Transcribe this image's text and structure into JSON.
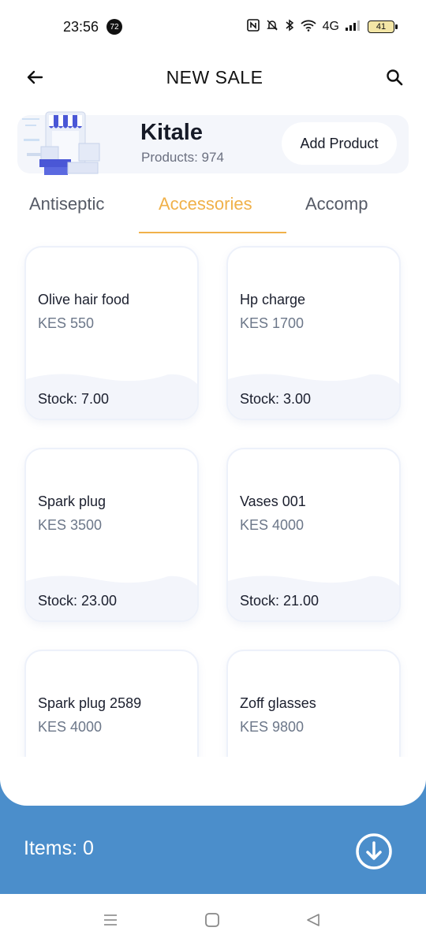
{
  "status_bar": {
    "time": "23:56",
    "notification_count": "72",
    "network": "4G",
    "battery": "41"
  },
  "header": {
    "title": "NEW SALE",
    "back_icon": "arrow-left-icon",
    "search_icon": "search-icon"
  },
  "store": {
    "name": "Kitale",
    "products": "Products: 974",
    "add_product_label": "Add Product"
  },
  "tabs": [
    {
      "label": "Antiseptic",
      "active": false
    },
    {
      "label": "Accessories",
      "active": true
    },
    {
      "label": "Accomp",
      "active": false
    }
  ],
  "products": [
    {
      "name": "Olive hair food",
      "price": "KES 550",
      "stock": "Stock: 7.00"
    },
    {
      "name": "Hp charge",
      "price": "KES 1700",
      "stock": "Stock: 3.00"
    },
    {
      "name": "Spark plug",
      "price": "KES 3500",
      "stock": "Stock: 23.00"
    },
    {
      "name": "Vases 001",
      "price": "KES 4000",
      "stock": "Stock: 21.00"
    },
    {
      "name": "Spark plug  2589",
      "price": "KES 4000",
      "stock": ""
    },
    {
      "name": "Zoff glasses",
      "price": "KES 9800",
      "stock": ""
    }
  ],
  "footer": {
    "items_label": "Items: 0",
    "download_icon": "arrow-down-circle-icon"
  },
  "colors": {
    "accent": "#f0b14a",
    "footer_blue": "#4b8ecb",
    "price_text": "#6c7789"
  }
}
